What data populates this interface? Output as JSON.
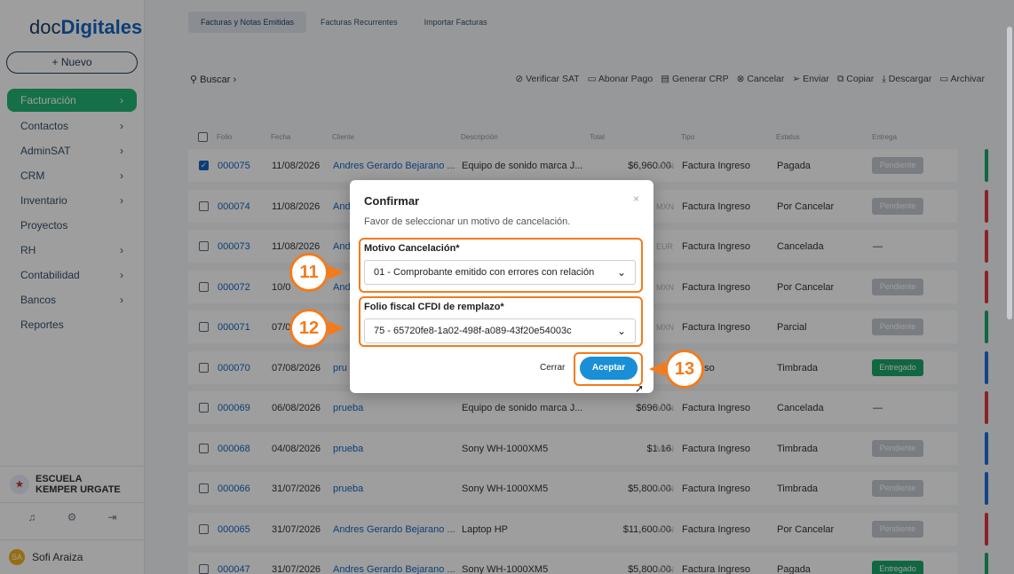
{
  "logo": {
    "part1": "doc",
    "part2": "Digitales"
  },
  "sidebar": {
    "new_label": "+ Nuevo",
    "items": [
      {
        "label": "Facturación",
        "chevron": true,
        "active": true
      },
      {
        "label": "Contactos",
        "chevron": true
      },
      {
        "label": "AdminSAT",
        "chevron": true
      },
      {
        "label": "CRM",
        "chevron": true
      },
      {
        "label": "Inventario",
        "chevron": true
      },
      {
        "label": "Proyectos",
        "chevron": false
      },
      {
        "label": "RH",
        "chevron": true
      },
      {
        "label": "Contabilidad",
        "chevron": true
      },
      {
        "label": "Bancos",
        "chevron": true
      },
      {
        "label": "Reportes",
        "chevron": false
      }
    ],
    "org_name": "ESCUELA KEMPER URGATE",
    "user_name": "Sofi Araiza",
    "user_initials": "SA"
  },
  "tabs": [
    "Facturas y Notas Emitidas",
    "Facturas Recurrentes",
    "Importar Facturas"
  ],
  "search_label": "Buscar",
  "toolbar": [
    "Verificar SAT",
    "Abonar Pago",
    "Generar CRP",
    "Cancelar",
    "Enviar",
    "Copiar",
    "Descargar",
    "Archivar"
  ],
  "table": {
    "headers": [
      "Folio",
      "Fecha",
      "Cliente",
      "Descripción",
      "Total",
      "Tipo",
      "Estatus",
      "Entrega"
    ],
    "rows": [
      {
        "folio": "000075",
        "fecha": "11/08/2026",
        "cliente": "Andres Gerardo Bejarano ...",
        "desc": "Equipo de sonido marca J...",
        "total": "$6,960.00",
        "cur": "MXN",
        "tipo": "Factura Ingreso",
        "estatus": "Pagada",
        "entrega": "Pendiente",
        "checked": true,
        "bar": "#1aa66a"
      },
      {
        "folio": "000074",
        "fecha": "11/08/2026",
        "cliente": "And",
        "desc": "",
        "total": "",
        "cur": "MXN",
        "tipo": "Factura Ingreso",
        "estatus": "Por Cancelar",
        "entrega": "Pendiente",
        "bar": "#e0383e"
      },
      {
        "folio": "000073",
        "fecha": "11/08/2026",
        "cliente": "And",
        "desc": "",
        "total": "",
        "cur": "EUR",
        "tipo": "Factura Ingreso",
        "estatus": "Cancelada",
        "entrega": "—",
        "bar": "#e0383e"
      },
      {
        "folio": "000072",
        "fecha": "10/0",
        "cliente": "And",
        "desc": "",
        "total": "",
        "cur": "MXN",
        "tipo": "Factura Ingreso",
        "estatus": "Por Cancelar",
        "entrega": "Pendiente",
        "bar": "#e0383e"
      },
      {
        "folio": "000071",
        "fecha": "07/0",
        "cliente": "",
        "desc": "",
        "total": "",
        "cur": "MXN",
        "tipo": "Factura Ingreso",
        "estatus": "Parcial",
        "entrega": "Pendiente",
        "bar": "#1aa66a"
      },
      {
        "folio": "000070",
        "fecha": "07/08/2026",
        "cliente": "pru",
        "desc": "",
        "total": "",
        "cur": "",
        "tipo": "Ingreso",
        "estatus": "Timbrada",
        "entrega": "Entregado",
        "bar": "#1e6fd9"
      },
      {
        "folio": "000069",
        "fecha": "06/08/2026",
        "cliente": "prueba",
        "desc": "Equipo de sonido marca J...",
        "total": "$696.00",
        "cur": "MXN",
        "tipo": "Factura Ingreso",
        "estatus": "Cancelada",
        "entrega": "—",
        "bar": "#e0383e"
      },
      {
        "folio": "000068",
        "fecha": "04/08/2026",
        "cliente": "prueba",
        "desc": "Sony WH-1000XM5",
        "total": "$1.16",
        "cur": "MXN",
        "tipo": "Factura Ingreso",
        "estatus": "Timbrada",
        "entrega": "Pendiente",
        "bar": "#1e6fd9"
      },
      {
        "folio": "000066",
        "fecha": "31/07/2026",
        "cliente": "prueba",
        "desc": "Sony WH-1000XM5",
        "total": "$5,800.00",
        "cur": "MXN",
        "tipo": "Factura Ingreso",
        "estatus": "Timbrada",
        "entrega": "Pendiente",
        "bar": "#1e6fd9"
      },
      {
        "folio": "000065",
        "fecha": "31/07/2026",
        "cliente": "Andres Gerardo Bejarano ...",
        "desc": "Laptop HP",
        "total": "$11,600.00",
        "cur": "MXN",
        "tipo": "Factura Ingreso",
        "estatus": "Por Cancelar",
        "entrega": "Pendiente",
        "bar": "#e0383e"
      },
      {
        "folio": "000047",
        "fecha": "31/07/2026",
        "cliente": "Andres Gerardo Bejarano ...",
        "desc": "Sony WH-1000XM5",
        "total": "$5,800.00",
        "cur": "MXN",
        "tipo": "Factura Ingreso",
        "estatus": "Pagada",
        "entrega": "Entregado",
        "bar": "#1aa66a"
      }
    ]
  },
  "modal": {
    "title": "Confirmar",
    "close": "×",
    "description": "Favor de seleccionar un motivo de cancelación.",
    "field1_label": "Motivo Cancelación*",
    "field1_value": "01 - Comprobante emitido con errores con relación",
    "field2_label": "Folio fiscal CFDI de remplazo*",
    "field2_value": "75 - 65720fe8-1a02-498f-a089-43f20e54003c",
    "cancel_label": "Cerrar",
    "confirm_label": "Aceptar"
  },
  "steps": [
    "11",
    "12",
    "13"
  ],
  "colors": {
    "accent": "#22b573",
    "link": "#1565c0",
    "callout": "#f27b1d",
    "primary_btn": "#1a8fd6"
  }
}
